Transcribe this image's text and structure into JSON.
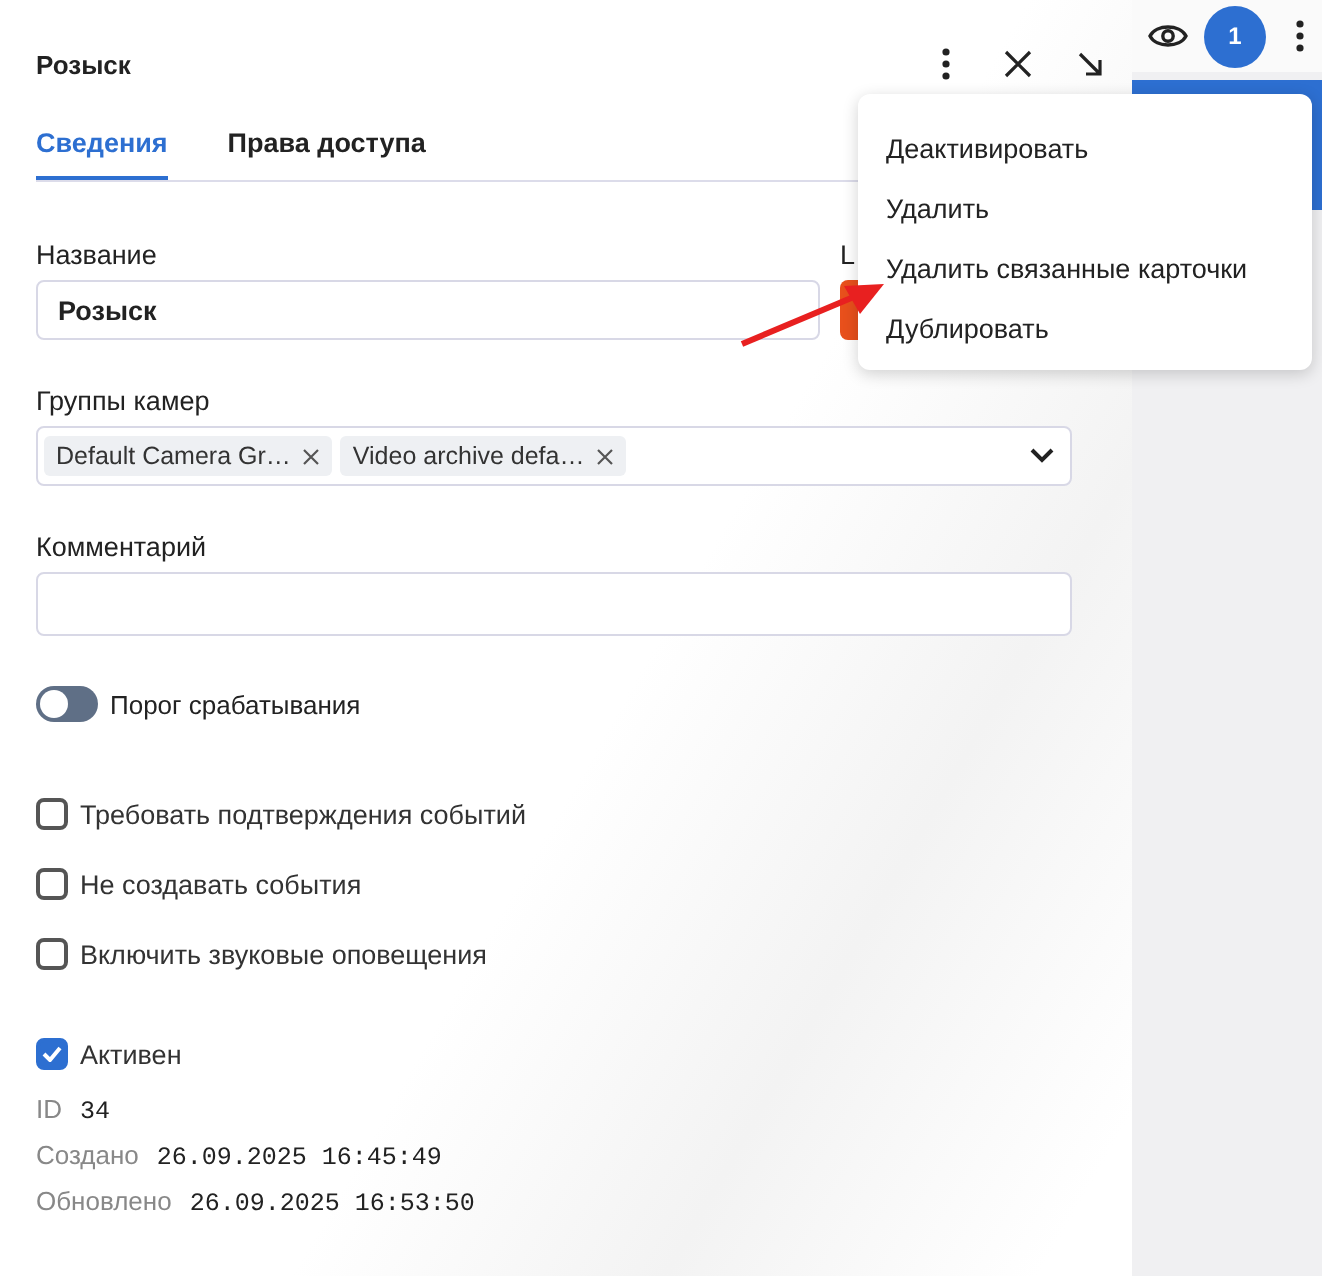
{
  "header": {
    "title": "Розыск"
  },
  "tabs": [
    {
      "label": "Сведения",
      "selected": true
    },
    {
      "label": "Права доступа",
      "selected": false
    }
  ],
  "name_field": {
    "label": "Название",
    "value": "Розыск"
  },
  "color_field": {
    "label": "L",
    "color": "#e8501c"
  },
  "camera_groups": {
    "label": "Группы камер",
    "chips": [
      "Default Camera Gr…",
      "Video archive defa…"
    ]
  },
  "comment": {
    "label": "Комментарий"
  },
  "threshold_toggle": {
    "label": "Порог срабатывания",
    "on": false
  },
  "options": [
    {
      "label": "Требовать подтверждения событий",
      "checked": false
    },
    {
      "label": "Не создавать события",
      "checked": false
    },
    {
      "label": "Включить звуковые оповещения",
      "checked": false
    }
  ],
  "active": {
    "label": "Активен",
    "checked": true
  },
  "meta": [
    {
      "label": "ID",
      "value": "34"
    },
    {
      "label": "Создано",
      "value": "26.09.2025 16:45:49"
    },
    {
      "label": "Обновлено",
      "value": "26.09.2025 16:53:50"
    }
  ],
  "menu": {
    "items": [
      "Деактивировать",
      "Удалить",
      "Удалить связанные карточки",
      "Дублировать"
    ]
  },
  "side": {
    "badge": "1"
  }
}
